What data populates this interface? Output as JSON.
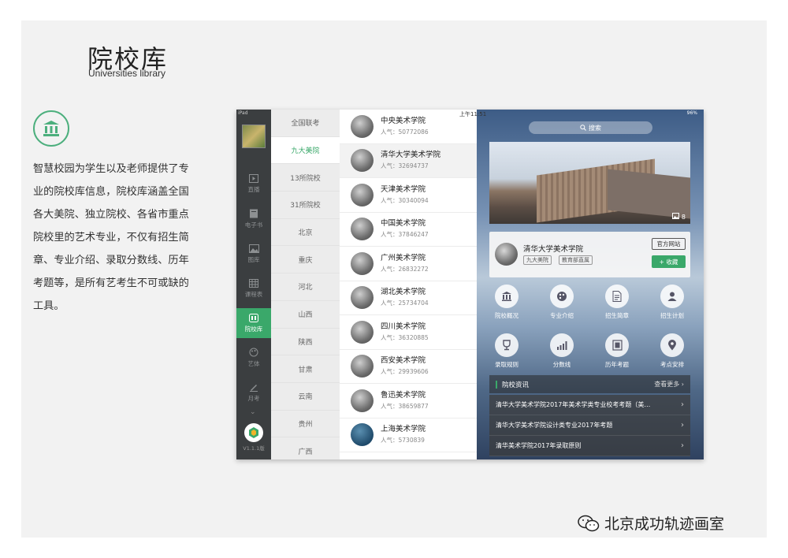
{
  "title": "院校库",
  "subtitle": "Universities library",
  "description": "智慧校园为学生以及老师提供了专业的院校库信息，院校库涵盖全国各大美院、独立院校、各省市重点院校里的艺术专业，不仅有招生简章、专业介绍、录取分数线、历年考题等，是所有艺考生不可或缺的工具。",
  "status": {
    "carrier": "iPad",
    "time": "上午11:51",
    "battery": "96%"
  },
  "rail": {
    "items": [
      {
        "label": "直播",
        "icon": "play-icon"
      },
      {
        "label": "电子书",
        "icon": "book-icon"
      },
      {
        "label": "图库",
        "icon": "image-icon"
      },
      {
        "label": "课程表",
        "icon": "calendar-icon"
      },
      {
        "label": "院校库",
        "icon": "library-icon",
        "active": true
      },
      {
        "label": "艺体",
        "icon": "palette-icon"
      },
      {
        "label": "月考",
        "icon": "pen-icon"
      }
    ],
    "version": "V1.1.1版"
  },
  "regions": [
    "全国联考",
    "九大美院",
    "13所院校",
    "31所院校",
    "北京",
    "重庆",
    "河北",
    "山西",
    "陕西",
    "甘肃",
    "云南",
    "贵州",
    "广西"
  ],
  "schools": [
    {
      "name": "中央美术学院",
      "popularity": "人气：50772086"
    },
    {
      "name": "清华大学美术学院",
      "popularity": "人气：32694737"
    },
    {
      "name": "天津美术学院",
      "popularity": "人气：30340094"
    },
    {
      "name": "中国美术学院",
      "popularity": "人气：37846247"
    },
    {
      "name": "广州美术学院",
      "popularity": "人气：26832272"
    },
    {
      "name": "湖北美术学院",
      "popularity": "人气：25734704"
    },
    {
      "name": "四川美术学院",
      "popularity": "人气：36320885"
    },
    {
      "name": "西安美术学院",
      "popularity": "人气：29939606"
    },
    {
      "name": "鲁迅美术学院",
      "popularity": "人气：38659877"
    },
    {
      "name": "上海美术学院",
      "popularity": "人气：5730839"
    }
  ],
  "detail": {
    "search_label": "搜索",
    "photo_count": "8",
    "school_name": "清华大学美术学院",
    "tags": [
      "九大美院",
      "教育部直属"
    ],
    "official_site": "官方网站",
    "favorite": "+ 收藏",
    "functions": [
      {
        "label": "院校概况",
        "icon": "building-icon"
      },
      {
        "label": "专业介绍",
        "icon": "palette-icon"
      },
      {
        "label": "招生简章",
        "icon": "document-icon"
      },
      {
        "label": "招生计划",
        "icon": "person-icon"
      },
      {
        "label": "录取规则",
        "icon": "trophy-icon"
      },
      {
        "label": "分数线",
        "icon": "bar-chart-icon"
      },
      {
        "label": "历年考题",
        "icon": "exam-icon"
      },
      {
        "label": "考点安排",
        "icon": "location-icon"
      }
    ],
    "news_title": "院校资讯",
    "news_more": "查看更多",
    "news": [
      "清华大学美术学院2017年美术学类专业校考考题（美…",
      "清华大学美术学院设计类专业2017年考题",
      "清华美术学院2017年录取原则"
    ]
  },
  "watermark": "北京成功轨迹画室"
}
